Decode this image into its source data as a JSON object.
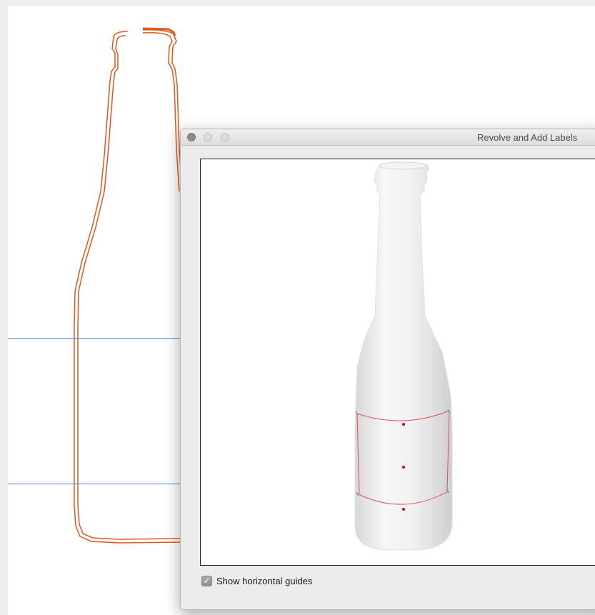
{
  "dialog": {
    "title": "Revolve and Add Labels",
    "show_guides_label": "Show horizontal guides",
    "show_guides_checked": true,
    "check_glyph": "✓"
  },
  "icons": {
    "close": "close-icon",
    "minimize": "minimize-icon",
    "zoom": "zoom-icon",
    "checkbox": "checkbox-checked-icon"
  },
  "colors": {
    "outline": "#e2571c",
    "guide": "#5b84e6",
    "label_frame": "#e84b4b",
    "label_point": "#e0001a"
  }
}
